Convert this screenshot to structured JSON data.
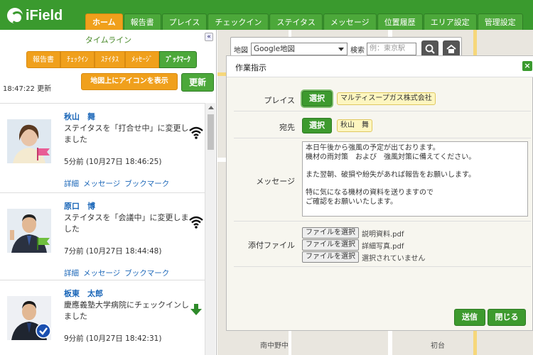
{
  "app": {
    "logo": "iField"
  },
  "nav": {
    "tabs": [
      {
        "label": "ホーム",
        "active": true
      },
      {
        "label": "報告書"
      },
      {
        "label": "プレイス"
      },
      {
        "label": "チェックイン"
      },
      {
        "label": "ステイタス"
      },
      {
        "label": "メッセージ"
      },
      {
        "label": "位置履歴"
      },
      {
        "label": "エリア設定"
      },
      {
        "label": "管理設定"
      }
    ]
  },
  "sidebar": {
    "title": "タイムライン",
    "collapse": "«",
    "filter_tabs": [
      {
        "label": "報告書"
      },
      {
        "label": "ﾁｪｯｸｲﾝ"
      },
      {
        "label": "ｽﾃｲﾀｽ"
      },
      {
        "label": "ﾒｯｾｰｼﾞ"
      },
      {
        "label": "ﾌﾞｯｸﾏｰｸ",
        "active": true
      }
    ],
    "update_time": "18:47:22 更新",
    "map_icon_button": "地図上にアイコンを表示",
    "refresh_button": "更新",
    "links": {
      "detail": "詳細",
      "message": "メッセージ",
      "bookmark": "ブックマーク"
    },
    "items": [
      {
        "name": "秋山　舞",
        "message": "ステイタスを「打合せ中」に変更しました",
        "time": "5分前 (10月27日 18:46:25)",
        "flag": "pink",
        "icon": "wifi-icon"
      },
      {
        "name": "原口　博",
        "message": "ステイタスを「会議中」に変更しました",
        "time": "7分前 (10月27日 18:44:48)",
        "flag": "green",
        "icon": "wifi-icon"
      },
      {
        "name": "板東　太郎",
        "message": "慶應義塾大学病院にチェックインしました",
        "time": "9分前 (10月27日 18:42:31)",
        "flag": "check",
        "icon": "down-arrow-icon"
      }
    ]
  },
  "map": {
    "type_label": "地図",
    "type_value": "Google地図",
    "search_label": "検索",
    "search_placeholder": "例：東京駅",
    "place_labels": [
      "南中野中",
      "初台"
    ]
  },
  "modal": {
    "title": "作業指示",
    "close": "×",
    "place_label": "プレイス",
    "place_select": "選択",
    "place_value": "マルティスープガス株式会社",
    "recipient_label": "宛先",
    "recipient_select": "選択",
    "recipient_value": "秋山　舞",
    "message_label": "メッセージ",
    "message_text": "本日午後から強風の予定が出ております。\n機材の雨対策　および　強風対策に備えてください。\n\nまた翌朝、破損や紛失があれば報告をお願いします。\n\n特に気になる機材の資料を送りますので\nご確認をお願いいたします。",
    "attach_label": "添付ファイル",
    "file_button": "ファイルを選択",
    "files": [
      "説明資料.pdf",
      "詳細写真.pdf",
      "選択されていません"
    ],
    "send": "送信",
    "close_button": "閉じる"
  },
  "colors": {
    "header": "#3a9a2e",
    "accent": "#f0a01c",
    "link": "#1a66b8"
  }
}
